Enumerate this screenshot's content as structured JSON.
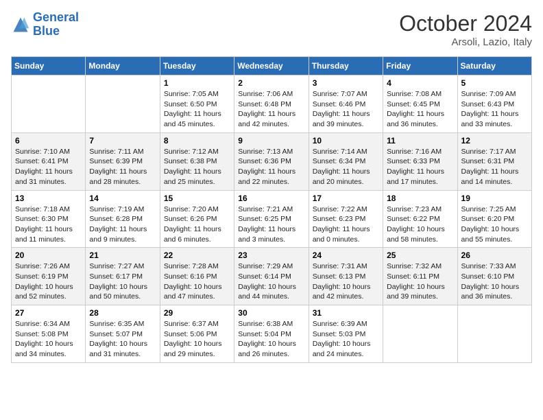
{
  "logo": {
    "line1": "General",
    "line2": "Blue"
  },
  "title": "October 2024",
  "location": "Arsoli, Lazio, Italy",
  "days_of_week": [
    "Sunday",
    "Monday",
    "Tuesday",
    "Wednesday",
    "Thursday",
    "Friday",
    "Saturday"
  ],
  "weeks": [
    [
      {
        "day": null,
        "info": null
      },
      {
        "day": null,
        "info": null
      },
      {
        "day": "1",
        "sunrise": "Sunrise: 7:05 AM",
        "sunset": "Sunset: 6:50 PM",
        "daylight": "Daylight: 11 hours and 45 minutes."
      },
      {
        "day": "2",
        "sunrise": "Sunrise: 7:06 AM",
        "sunset": "Sunset: 6:48 PM",
        "daylight": "Daylight: 11 hours and 42 minutes."
      },
      {
        "day": "3",
        "sunrise": "Sunrise: 7:07 AM",
        "sunset": "Sunset: 6:46 PM",
        "daylight": "Daylight: 11 hours and 39 minutes."
      },
      {
        "day": "4",
        "sunrise": "Sunrise: 7:08 AM",
        "sunset": "Sunset: 6:45 PM",
        "daylight": "Daylight: 11 hours and 36 minutes."
      },
      {
        "day": "5",
        "sunrise": "Sunrise: 7:09 AM",
        "sunset": "Sunset: 6:43 PM",
        "daylight": "Daylight: 11 hours and 33 minutes."
      }
    ],
    [
      {
        "day": "6",
        "sunrise": "Sunrise: 7:10 AM",
        "sunset": "Sunset: 6:41 PM",
        "daylight": "Daylight: 11 hours and 31 minutes."
      },
      {
        "day": "7",
        "sunrise": "Sunrise: 7:11 AM",
        "sunset": "Sunset: 6:39 PM",
        "daylight": "Daylight: 11 hours and 28 minutes."
      },
      {
        "day": "8",
        "sunrise": "Sunrise: 7:12 AM",
        "sunset": "Sunset: 6:38 PM",
        "daylight": "Daylight: 11 hours and 25 minutes."
      },
      {
        "day": "9",
        "sunrise": "Sunrise: 7:13 AM",
        "sunset": "Sunset: 6:36 PM",
        "daylight": "Daylight: 11 hours and 22 minutes."
      },
      {
        "day": "10",
        "sunrise": "Sunrise: 7:14 AM",
        "sunset": "Sunset: 6:34 PM",
        "daylight": "Daylight: 11 hours and 20 minutes."
      },
      {
        "day": "11",
        "sunrise": "Sunrise: 7:16 AM",
        "sunset": "Sunset: 6:33 PM",
        "daylight": "Daylight: 11 hours and 17 minutes."
      },
      {
        "day": "12",
        "sunrise": "Sunrise: 7:17 AM",
        "sunset": "Sunset: 6:31 PM",
        "daylight": "Daylight: 11 hours and 14 minutes."
      }
    ],
    [
      {
        "day": "13",
        "sunrise": "Sunrise: 7:18 AM",
        "sunset": "Sunset: 6:30 PM",
        "daylight": "Daylight: 11 hours and 11 minutes."
      },
      {
        "day": "14",
        "sunrise": "Sunrise: 7:19 AM",
        "sunset": "Sunset: 6:28 PM",
        "daylight": "Daylight: 11 hours and 9 minutes."
      },
      {
        "day": "15",
        "sunrise": "Sunrise: 7:20 AM",
        "sunset": "Sunset: 6:26 PM",
        "daylight": "Daylight: 11 hours and 6 minutes."
      },
      {
        "day": "16",
        "sunrise": "Sunrise: 7:21 AM",
        "sunset": "Sunset: 6:25 PM",
        "daylight": "Daylight: 11 hours and 3 minutes."
      },
      {
        "day": "17",
        "sunrise": "Sunrise: 7:22 AM",
        "sunset": "Sunset: 6:23 PM",
        "daylight": "Daylight: 11 hours and 0 minutes."
      },
      {
        "day": "18",
        "sunrise": "Sunrise: 7:23 AM",
        "sunset": "Sunset: 6:22 PM",
        "daylight": "Daylight: 10 hours and 58 minutes."
      },
      {
        "day": "19",
        "sunrise": "Sunrise: 7:25 AM",
        "sunset": "Sunset: 6:20 PM",
        "daylight": "Daylight: 10 hours and 55 minutes."
      }
    ],
    [
      {
        "day": "20",
        "sunrise": "Sunrise: 7:26 AM",
        "sunset": "Sunset: 6:19 PM",
        "daylight": "Daylight: 10 hours and 52 minutes."
      },
      {
        "day": "21",
        "sunrise": "Sunrise: 7:27 AM",
        "sunset": "Sunset: 6:17 PM",
        "daylight": "Daylight: 10 hours and 50 minutes."
      },
      {
        "day": "22",
        "sunrise": "Sunrise: 7:28 AM",
        "sunset": "Sunset: 6:16 PM",
        "daylight": "Daylight: 10 hours and 47 minutes."
      },
      {
        "day": "23",
        "sunrise": "Sunrise: 7:29 AM",
        "sunset": "Sunset: 6:14 PM",
        "daylight": "Daylight: 10 hours and 44 minutes."
      },
      {
        "day": "24",
        "sunrise": "Sunrise: 7:31 AM",
        "sunset": "Sunset: 6:13 PM",
        "daylight": "Daylight: 10 hours and 42 minutes."
      },
      {
        "day": "25",
        "sunrise": "Sunrise: 7:32 AM",
        "sunset": "Sunset: 6:11 PM",
        "daylight": "Daylight: 10 hours and 39 minutes."
      },
      {
        "day": "26",
        "sunrise": "Sunrise: 7:33 AM",
        "sunset": "Sunset: 6:10 PM",
        "daylight": "Daylight: 10 hours and 36 minutes."
      }
    ],
    [
      {
        "day": "27",
        "sunrise": "Sunrise: 6:34 AM",
        "sunset": "Sunset: 5:08 PM",
        "daylight": "Daylight: 10 hours and 34 minutes."
      },
      {
        "day": "28",
        "sunrise": "Sunrise: 6:35 AM",
        "sunset": "Sunset: 5:07 PM",
        "daylight": "Daylight: 10 hours and 31 minutes."
      },
      {
        "day": "29",
        "sunrise": "Sunrise: 6:37 AM",
        "sunset": "Sunset: 5:06 PM",
        "daylight": "Daylight: 10 hours and 29 minutes."
      },
      {
        "day": "30",
        "sunrise": "Sunrise: 6:38 AM",
        "sunset": "Sunset: 5:04 PM",
        "daylight": "Daylight: 10 hours and 26 minutes."
      },
      {
        "day": "31",
        "sunrise": "Sunrise: 6:39 AM",
        "sunset": "Sunset: 5:03 PM",
        "daylight": "Daylight: 10 hours and 24 minutes."
      },
      {
        "day": null,
        "info": null
      },
      {
        "day": null,
        "info": null
      }
    ]
  ]
}
